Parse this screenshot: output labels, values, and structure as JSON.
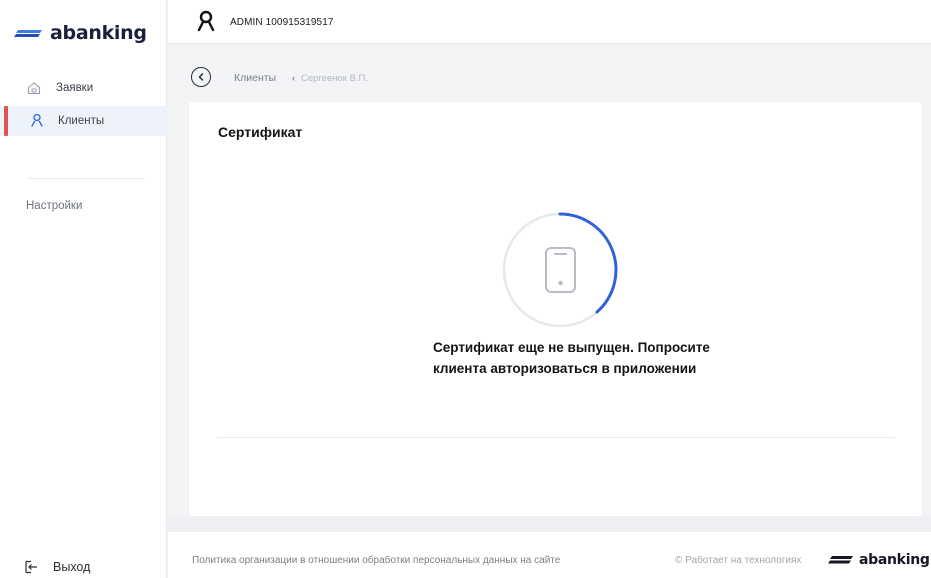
{
  "brand": {
    "name": "abanking",
    "accent": "#2a6fdb",
    "active_marker": "#e0524d"
  },
  "sidebar": {
    "items": [
      {
        "label": "Заявки",
        "icon": "home-icon"
      },
      {
        "label": "Клиенты",
        "icon": "user-icon",
        "active": true
      }
    ],
    "settings_label": "Настройки",
    "logout_label": "Выход"
  },
  "header": {
    "user": "ADMIN 100915319517"
  },
  "breadcrumb": {
    "items": [
      "Клиенты",
      "Сергеенок В.П."
    ]
  },
  "card": {
    "title": "Сертификат",
    "message": "Сертификат еще не выпущен. Попросите клиента авторизоваться в приложении",
    "spinner_color": "#2f63d8",
    "spinner_track_color": "#e6e8ec"
  },
  "footer": {
    "policy_link": "Политика организации в отношении обработки персональных данных на сайте",
    "powered_by": "© Работает на технологиях",
    "logo_text": "abanking"
  }
}
